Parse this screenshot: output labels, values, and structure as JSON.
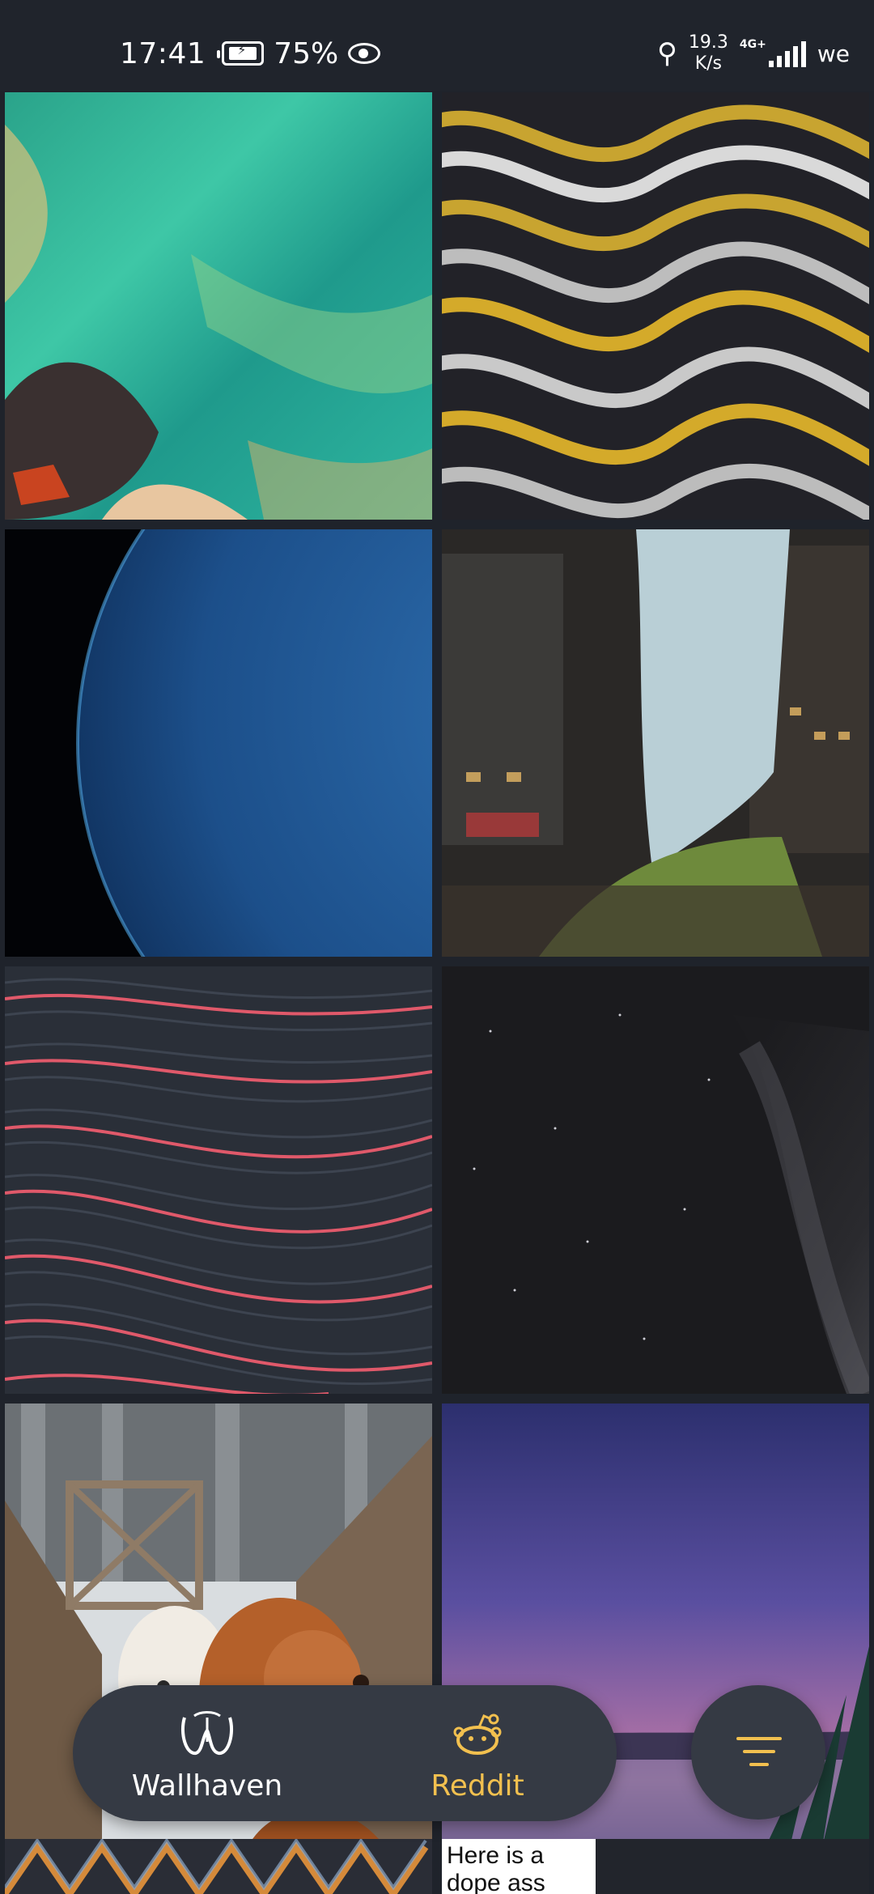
{
  "status_bar": {
    "time": "17:41",
    "battery": "75%",
    "net_speed_value": "19.3",
    "net_speed_unit": "K/s",
    "network_type": "4G+",
    "carrier": "we"
  },
  "grid": {
    "tiles": [
      {
        "name": "tile-turquoise-coast"
      },
      {
        "name": "tile-yellow-waves"
      },
      {
        "name": "tile-blue-planet"
      },
      {
        "name": "tile-city-forest"
      },
      {
        "name": "tile-pink-lines"
      },
      {
        "name": "tile-milky-way"
      },
      {
        "name": "tile-dogs-snow-bridge"
      },
      {
        "name": "tile-sunset-lake"
      },
      {
        "name": "tile-orange-pattern"
      },
      {
        "name": "tile-text-post",
        "caption": "Here is a dope ass picture of"
      }
    ]
  },
  "nav": {
    "wallhaven_label": "Wallhaven",
    "reddit_label": "Reddit",
    "wallhaven_icon": "wallhaven-w-icon",
    "reddit_icon": "reddit-alien-icon",
    "filter_icon": "filter-lines-icon",
    "accent": "#f2c04f"
  }
}
